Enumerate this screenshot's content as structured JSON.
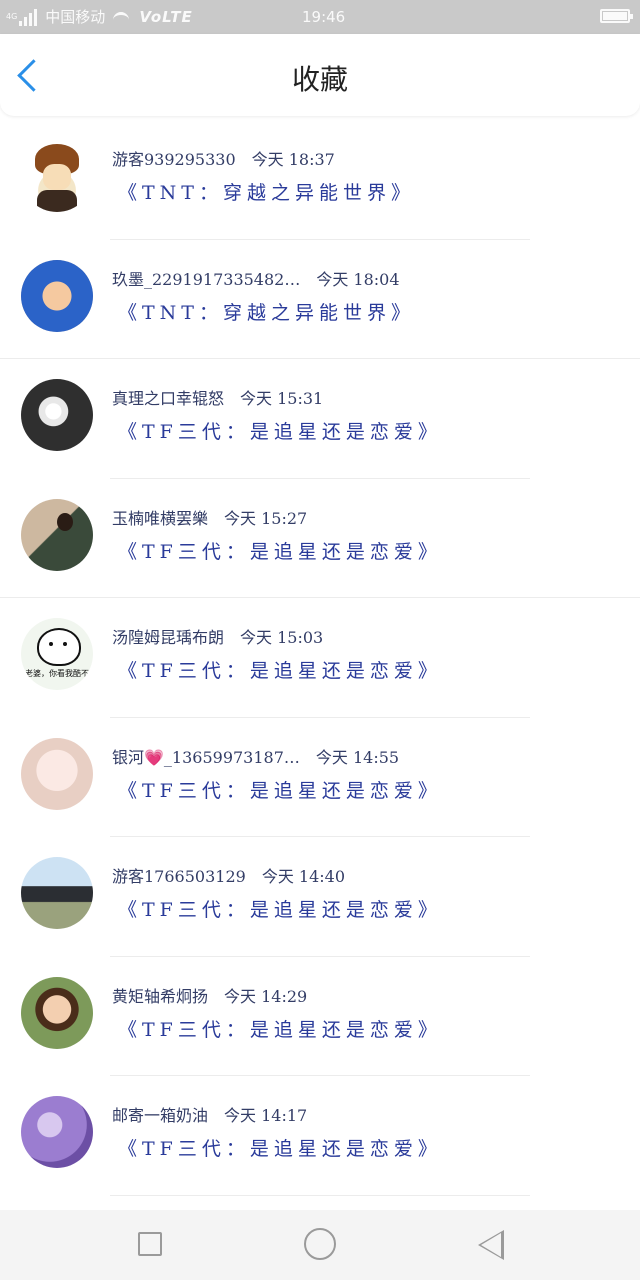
{
  "status_bar": {
    "network_type": "4G",
    "carrier": "中国移动",
    "volte": "VoLTE",
    "time": "19:46",
    "battery_icon": "battery-icon",
    "wifi_icon": "wifi-icon",
    "signal_icon": "signal-icon"
  },
  "header": {
    "title": "收藏",
    "back_icon": "chevron-left-icon",
    "accent_color": "#2a8fe8"
  },
  "items": [
    {
      "user": "游客939295330",
      "time": "今天 18:37",
      "book": "《TNT：穿越之异能世界》"
    },
    {
      "user": "玖墨_2291917335482…",
      "time": "今天 18:04",
      "book": "《TNT：穿越之异能世界》"
    },
    {
      "user": "真理之口幸辊怒",
      "time": "今天 15:31",
      "book": "《TF三代：是追星还是恋爱》"
    },
    {
      "user": "玉楠唯横罢樂",
      "time": "今天 15:27",
      "book": "《TF三代：是追星还是恋爱》"
    },
    {
      "user": "汤隍姆昆瑀布朗",
      "time": "今天 15:03",
      "book": "《TF三代：是追星还是恋爱》",
      "avatar_caption": "老婆，你看我酷不"
    },
    {
      "user": "银河💗_13659973187…",
      "time": "今天 14:55",
      "book": "《TF三代：是追星还是恋爱》"
    },
    {
      "user": "游客1766503129",
      "time": "今天 14:40",
      "book": "《TF三代：是追星还是恋爱》"
    },
    {
      "user": "黄矩轴希炯扬",
      "time": "今天 14:29",
      "book": "《TF三代：是追星还是恋爱》"
    },
    {
      "user": "邮寄一箱奶油",
      "time": "今天 14:17",
      "book": "《TF三代：是追星还是恋爱》"
    }
  ],
  "navbar": {
    "recents_icon": "square-icon",
    "home_icon": "circle-icon",
    "back_icon": "triangle-back-icon"
  }
}
